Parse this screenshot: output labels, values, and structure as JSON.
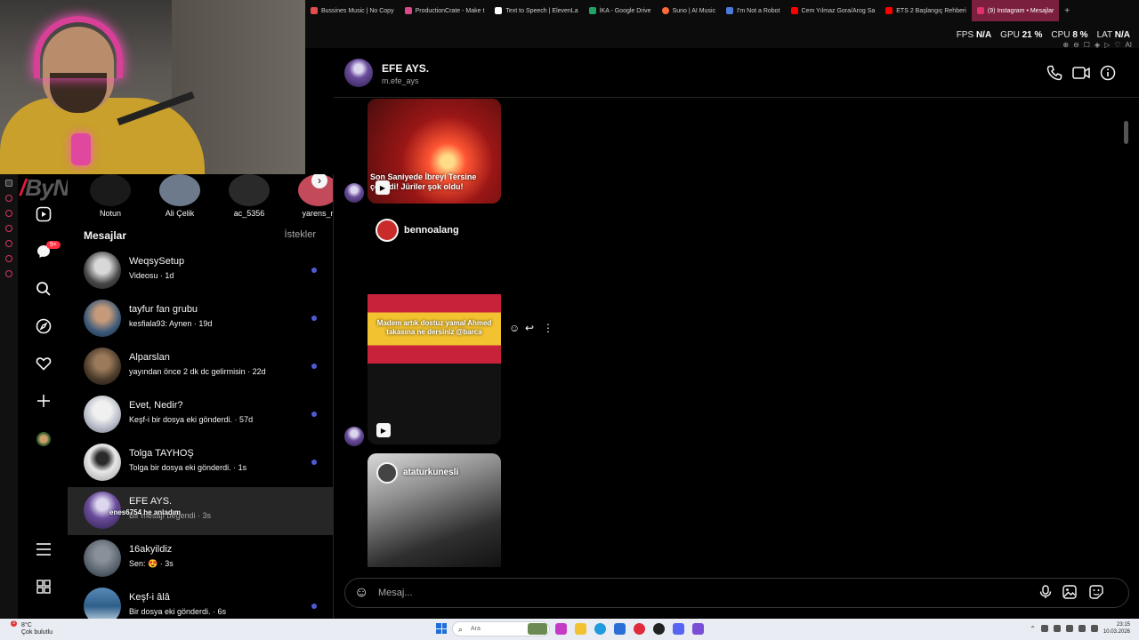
{
  "browser": {
    "tabs": [
      {
        "label": "Bussines Music | No Copy",
        "color": "#e34d4d"
      },
      {
        "label": "ProductionCrate - Make t",
        "color": "#d94a8c"
      },
      {
        "label": "Text to Speech | ElevenLa",
        "color": "#ffffff"
      },
      {
        "label": "İKA - Google Drive",
        "color": "#1fa463"
      },
      {
        "label": "Suno | AI Music",
        "color": "#ff6b3d"
      },
      {
        "label": "I'm Not a Robot",
        "color": "#4a7bd8"
      },
      {
        "label": "Cem Yılmaz Gora/Arog Sa",
        "color": "#ff0000"
      },
      {
        "label": "ETS 2 Başlangıç Rehberi",
        "color": "#ff0000"
      },
      {
        "label": "(9) Instagram • Mesajlar",
        "color": "#e1306c"
      }
    ],
    "add_tab": "+",
    "stats": {
      "fps_label": "FPS",
      "fps_value": "N/A",
      "gpu_label": "GPU",
      "gpu_value": "21 %",
      "cpu_label": "CPU",
      "cpu_value": "8 %",
      "lat_label": "LAT",
      "lat_value": "N/A"
    },
    "ai_label": "AI"
  },
  "stream": {
    "logo_text": "ByNoGame",
    "chat_overlay": "enes6754  he anladım"
  },
  "nav": {
    "notification_count": "9+"
  },
  "notes": [
    {
      "name": "Notun",
      "color": "#1a1a1a"
    },
    {
      "name": "Ali Çelik",
      "color": "#6d7a8c"
    },
    {
      "name": "ac_5356",
      "color": "#2a2a2a"
    },
    {
      "name": "yarens_n",
      "color": "#c24a5a"
    }
  ],
  "list": {
    "title": "Mesajlar",
    "requests": "İstekler",
    "conversations": [
      {
        "name": "WeqsySetup",
        "preview": "Videosu · 1d",
        "unread": true,
        "color": "#444444"
      },
      {
        "name": "tayfur fan grubu",
        "preview": "kesfiala93: Aynen · 19d",
        "unread": true,
        "color": "#3c5a7a"
      },
      {
        "name": "Alparslan",
        "preview": "yayından önce 2 dk dc gelirmisin · 22d",
        "unread": true,
        "color": "#4a3a2a"
      },
      {
        "name": "Evet, Nedir?",
        "preview": "Keşf-i bir dosya eki gönderdi. · 57d",
        "unread": true,
        "color": "#b8bcc8"
      },
      {
        "name": "Tolga TAYHOŞ",
        "preview": "Tolga bir dosya eki gönderdi. · 1s",
        "unread": true,
        "color": "#d8d8d8"
      },
      {
        "name": "EFE AYS.",
        "preview": "Bir mesajı beğendi · 3s",
        "unread": false,
        "active": true,
        "color": "#6b4d9c"
      },
      {
        "name": "16akyildiz",
        "preview": "Sen: 😍 · 3s",
        "unread": false,
        "color": "#5a6470"
      },
      {
        "name": "Keşf-i âlâ",
        "preview": "Bir dosya eki gönderdi. · 6s",
        "unread": true,
        "color": "#2e5f8a"
      }
    ]
  },
  "chat": {
    "name": "EFE AYS.",
    "username": "m.efe_ays",
    "posts": [
      {
        "caption": "Son Saniyede İbreyi Tersine çevirdi! Jüriler şok oldu!"
      },
      {
        "user": "bennoalang",
        "overlay": "Madem artık dostuz yamal Ahmed takasına ne dersiniz @barca"
      },
      {
        "user": "ataturkunesli"
      }
    ],
    "input_placeholder": "Mesaj..."
  },
  "taskbar": {
    "weather_temp": "8°C",
    "weather_desc": "Çok bulutlu",
    "weather_badge": "3",
    "search_placeholder": "Ara",
    "time": "23:15",
    "date": "10.03.2026"
  }
}
